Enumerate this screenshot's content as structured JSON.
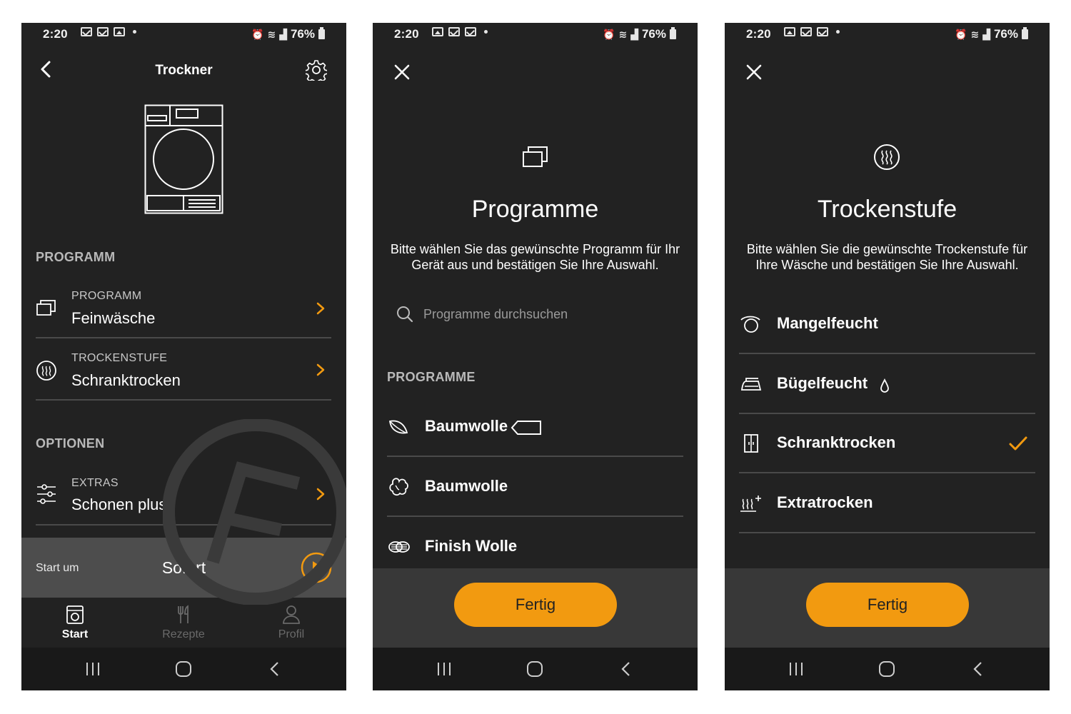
{
  "status_bar": {
    "time": "2:20",
    "battery": "76%"
  },
  "colors": {
    "background": "#222222",
    "accent": "#f29a10",
    "footer": "#383838",
    "start_bar": "#4d4d4d"
  },
  "screen1": {
    "title": "Trockner",
    "section_programm": "PROGRAMM",
    "program_row": {
      "label": "PROGRAMM",
      "value": "Feinwäsche",
      "icon": "program-icon"
    },
    "dry_row": {
      "label": "TROCKENSTUFE",
      "value": "Schranktrocken",
      "icon": "dry-level-icon"
    },
    "section_options": "OPTIONEN",
    "extras_row": {
      "label": "EXTRAS",
      "value": "Schonen plus",
      "icon": "sliders-icon"
    },
    "start": {
      "label": "Start um",
      "value": "Sofort"
    },
    "tabs": [
      {
        "label": "Start",
        "icon": "washer-icon",
        "active": true
      },
      {
        "label": "Rezepte",
        "icon": "cutlery-icon",
        "active": false
      },
      {
        "label": "Profil",
        "icon": "user-icon",
        "active": false
      }
    ]
  },
  "screen2": {
    "title": "Programme",
    "description": "Bitte wählen Sie das gewünschte Programm für Ihr Gerät aus und bestätigen Sie Ihre Auswahl.",
    "search_placeholder": "Programme durchsuchen",
    "section": "PROGRAMME",
    "items": [
      {
        "name": "Baumwolle",
        "icon": "leaf-icon",
        "tag": "eco-tag-icon"
      },
      {
        "name": "Baumwolle",
        "icon": "cotton-icon"
      },
      {
        "name": "Finish Wolle",
        "icon": "wool-icon"
      }
    ],
    "done_label": "Fertig"
  },
  "screen3": {
    "title": "Trockenstufe",
    "description": "Bitte wählen Sie die gewünschte Trockenstufe für Ihre Wäsche und bestätigen Sie Ihre Auswahl.",
    "items": [
      {
        "name": "Mangelfeucht",
        "icon": "mangle-icon",
        "selected": false
      },
      {
        "name": "Bügelfeucht",
        "icon": "iron-icon",
        "selected": false
      },
      {
        "name": "Schranktrocken",
        "icon": "cupboard-icon",
        "selected": true
      },
      {
        "name": "Extratrocken",
        "icon": "extra-dry-icon",
        "selected": false
      }
    ],
    "done_label": "Fertig"
  }
}
